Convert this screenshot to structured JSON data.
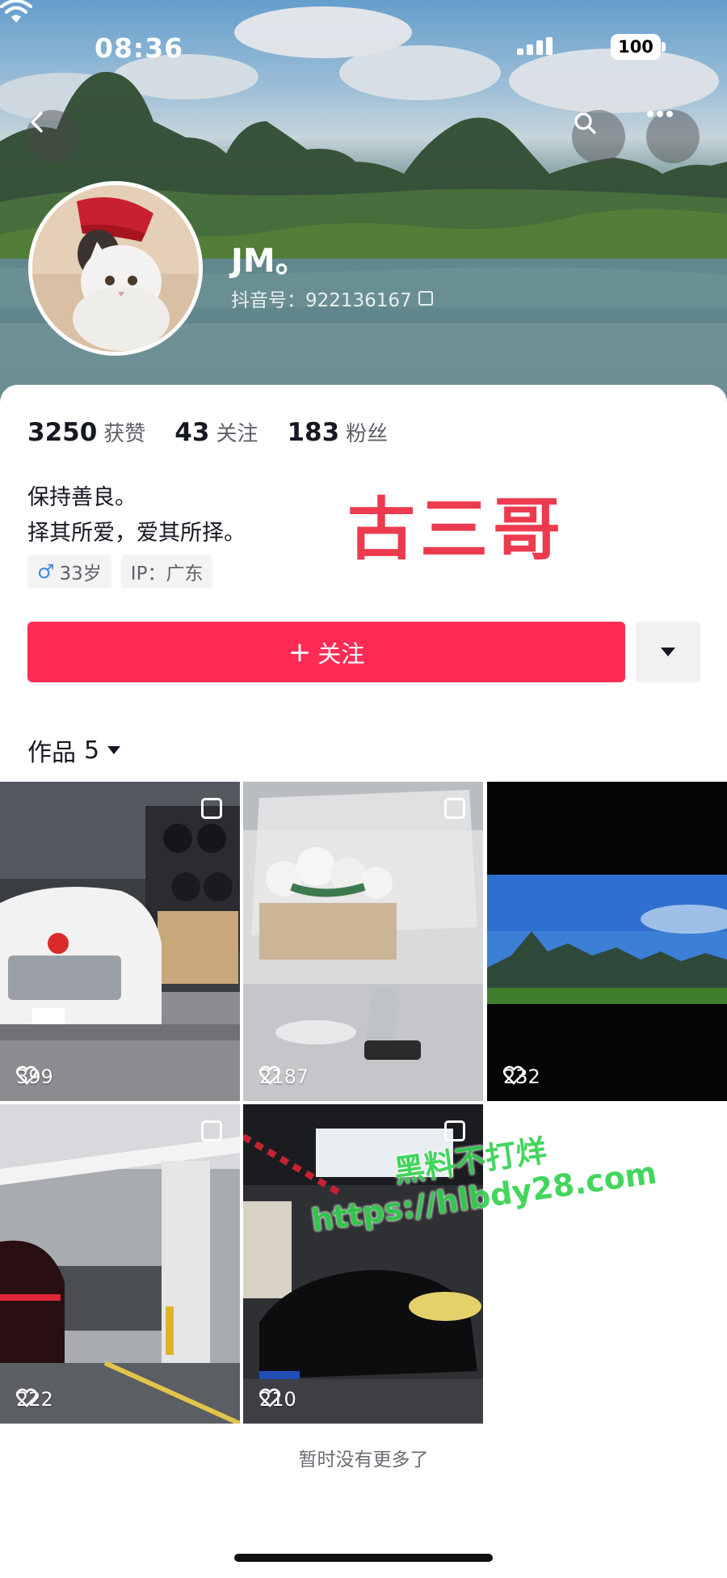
{
  "status_bar": {
    "time": "08:36",
    "battery": "100"
  },
  "header": {
    "nickname": "JM。",
    "douyin_id": "抖音号：922136167"
  },
  "stats": [
    {
      "value": "3250",
      "label": "获赞"
    },
    {
      "value": "43",
      "label": "关注"
    },
    {
      "value": "183",
      "label": "粉丝"
    }
  ],
  "bio": {
    "line1": "保持善良。",
    "line2": "择其所爱，爱其所择。"
  },
  "overlay_name": "古三哥",
  "tags": {
    "age": "33岁",
    "ip": "IP：广东"
  },
  "follow_button": {
    "label": "关注",
    "icon": "plus-icon"
  },
  "works": {
    "label": "作品",
    "count": "5",
    "items": [
      {
        "likes": "399"
      },
      {
        "likes": "2187"
      },
      {
        "likes": "232"
      },
      {
        "likes": "222"
      },
      {
        "likes": "210"
      }
    ]
  },
  "footer": {
    "end_text": "暂时没有更多了"
  },
  "watermark": {
    "line1": "黑料不打烊",
    "line2": "https://hlbdy28.com"
  },
  "colors": {
    "accent": "#fe2c55",
    "overlay": "#ec3b4e",
    "watermark": "#34d24f"
  }
}
